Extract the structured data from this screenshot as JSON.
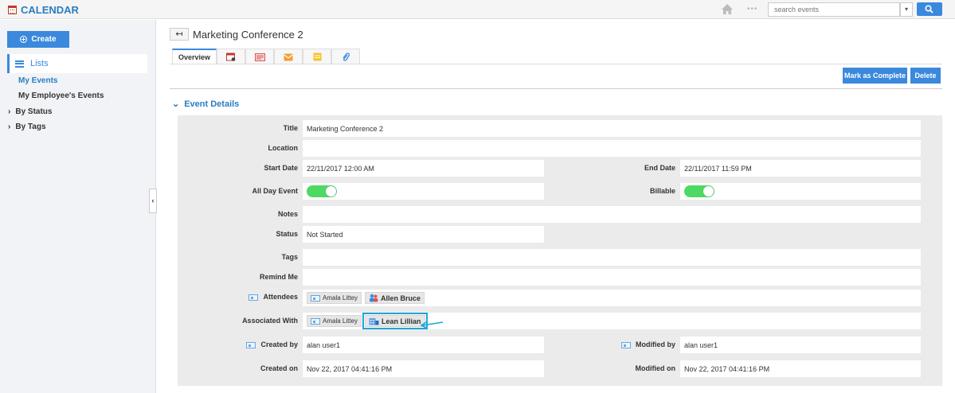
{
  "app": {
    "title": "CALENDAR"
  },
  "topbar": {
    "search_placeholder": "search events",
    "dots": "•••"
  },
  "sidebar": {
    "create_label": "Create",
    "lists_label": "Lists",
    "links": [
      {
        "label": "My Events",
        "active": true
      },
      {
        "label": "My Employee's Events",
        "active": false
      }
    ],
    "trees": [
      {
        "label": "By Status"
      },
      {
        "label": "By Tags"
      }
    ]
  },
  "page": {
    "title": "Marketing Conference 2",
    "tabs": [
      {
        "label": "Overview",
        "icon": "overview"
      },
      {
        "label": "",
        "icon": "calendar-icon"
      },
      {
        "label": "",
        "icon": "notes-icon"
      },
      {
        "label": "",
        "icon": "email-icon"
      },
      {
        "label": "",
        "icon": "sticky-note-icon"
      },
      {
        "label": "",
        "icon": "attachment-icon"
      }
    ],
    "actions": {
      "complete": "Mark as Complete",
      "delete": "Delete"
    },
    "section_title": "Event Details"
  },
  "fields": {
    "title": {
      "label": "Title",
      "value": "Marketing Conference 2"
    },
    "location": {
      "label": "Location",
      "value": ""
    },
    "start_date": {
      "label": "Start Date",
      "value": "22/11/2017 12:00 AM"
    },
    "end_date": {
      "label": "End Date",
      "value": "22/11/2017 11:59 PM"
    },
    "all_day": {
      "label": "All Day Event",
      "value": true
    },
    "billable": {
      "label": "Billable",
      "value": true
    },
    "notes": {
      "label": "Notes",
      "value": ""
    },
    "status": {
      "label": "Status",
      "value": "Not Started"
    },
    "tags": {
      "label": "Tags",
      "value": ""
    },
    "remind_me": {
      "label": "Remind Me",
      "value": ""
    },
    "attendees": {
      "label": "Attendees",
      "chips": [
        "Amala Littey",
        "Allen Bruce"
      ]
    },
    "associated_with": {
      "label": "Associated With",
      "chips": [
        "Amala Littey",
        "Lean Lillian"
      ]
    },
    "created_by": {
      "label": "Created by",
      "value": "alan user1"
    },
    "modified_by": {
      "label": "Modified by",
      "value": "alan user1"
    },
    "created_on": {
      "label": "Created on",
      "value": "Nov 22, 2017 04:41:16 PM"
    },
    "modified_on": {
      "label": "Modified on",
      "value": "Nov 22, 2017 04:41:16 PM"
    }
  },
  "colors": {
    "accent": "#3a89dd",
    "toggle_on": "#4cd964",
    "highlight": "#1ca7d8"
  }
}
